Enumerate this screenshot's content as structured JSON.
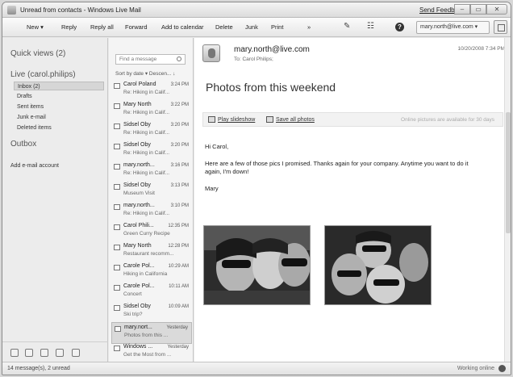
{
  "window": {
    "title": "Unread from contacts - Windows Live Mail",
    "send_feedback": "Send Feedback",
    "btn_min": "–",
    "btn_max": "▭",
    "btn_close": "✕"
  },
  "toolbar": {
    "new": "New",
    "reply": "Reply",
    "reply_all": "Reply all",
    "forward": "Forward",
    "add_to_calendar": "Add to calendar",
    "delete": "Delete",
    "junk": "Junk",
    "print": "Print",
    "more": "»",
    "account": "mary.north@live.com"
  },
  "nav": {
    "quick_views": "Quick views (2)",
    "live_account": "Live (carol.philips)",
    "folders": [
      "Inbox (2)",
      "Drafts",
      "Sent items",
      "Junk e-mail",
      "Deleted items"
    ],
    "outbox": "Outbox",
    "add_account": "Add e-mail account"
  },
  "list": {
    "search_placeholder": "Find a message",
    "sort": "Sort by date ▾   Descen... ↓",
    "messages": [
      {
        "from": "Carol Poland",
        "time": "3:24 PM",
        "subject": "Re: Hiking in Calif..."
      },
      {
        "from": "Mary North",
        "time": "3:22 PM",
        "subject": "Re: Hiking in Calif..."
      },
      {
        "from": "Sidsel Oby",
        "time": "3:20 PM",
        "subject": "Re: Hiking in Calif..."
      },
      {
        "from": "Sidsel Oby",
        "time": "3:20 PM",
        "subject": "Re: Hiking in Calif..."
      },
      {
        "from": "mary.north...",
        "time": "3:16 PM",
        "subject": "Re: Hiking in Calif..."
      },
      {
        "from": "Sidsel Oby",
        "time": "3:13 PM",
        "subject": "Museum Visit"
      },
      {
        "from": "mary.north...",
        "time": "3:10 PM",
        "subject": "Re: Hiking in Calif..."
      },
      {
        "from": "Carol Phili...",
        "time": "12:35 PM",
        "subject": "Green Curry Recipe"
      },
      {
        "from": "Mary North",
        "time": "12:28 PM",
        "subject": "Restaurant recomm..."
      },
      {
        "from": "Carole Pol...",
        "time": "10:29 AM",
        "subject": "Hiking in California"
      },
      {
        "from": "Carole Pol...",
        "time": "10:11 AM",
        "subject": "Concert"
      },
      {
        "from": "Sidsel Oby",
        "time": "10:09 AM",
        "subject": "Ski trip?"
      },
      {
        "from": "mary.nort...",
        "time": "Yesterday",
        "subject": "Photos from this ..."
      },
      {
        "from": "Windows ...",
        "time": "Yesterday",
        "subject": "Get the Most from ..."
      }
    ]
  },
  "reading": {
    "sender": "mary.north@live.com",
    "to": "To:  Carol Philips;",
    "date": "10/20/2008 7:34 PM",
    "subject": "Photos from this weekend",
    "play_slideshow": "Play slideshow",
    "save_all_photos": "Save all photos",
    "photos_note": "Online pictures are available for 30 days",
    "greeting": "Hi Carol,",
    "body1": "Here are a few of those pics I promised. Thanks again for your company. Anytime you want to do it",
    "body2": "again, I'm down!",
    "signature": "Mary"
  },
  "status": {
    "left": "14 message(s), 2 unread",
    "right": "Working online"
  }
}
